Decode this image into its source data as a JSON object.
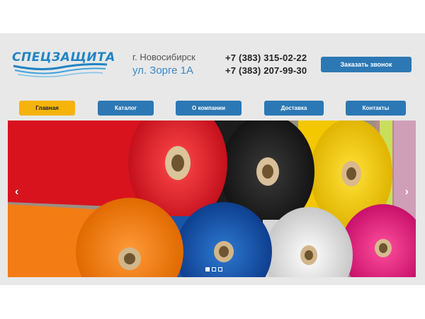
{
  "logo": {
    "text": "СПЕЦЗАЩИТА"
  },
  "address": {
    "city": "г. Новосибирск",
    "street": "ул. Зорге 1А"
  },
  "phones": [
    "+7 (383) 315-02-22",
    "+7 (383) 207-99-30"
  ],
  "callback_label": "Заказать звонок",
  "nav": [
    {
      "label": "Главная",
      "active": true
    },
    {
      "label": "Каталог",
      "active": false
    },
    {
      "label": "О компании",
      "active": false
    },
    {
      "label": "Доставка",
      "active": false
    },
    {
      "label": "Контакты",
      "active": false
    }
  ],
  "slider": {
    "prev_icon": "chevron-left-icon",
    "next_icon": "chevron-right-icon",
    "prev_glyph": "‹",
    "next_glyph": "›",
    "slide_count": 3,
    "active_slide": 1,
    "image": "fabric rolls in red, black, yellow, orange, blue, white and pink"
  },
  "colors": {
    "brand": "#1f84c4",
    "button": "#2c78b4",
    "active": "#f5b40b",
    "background": "#e8e8e8"
  }
}
